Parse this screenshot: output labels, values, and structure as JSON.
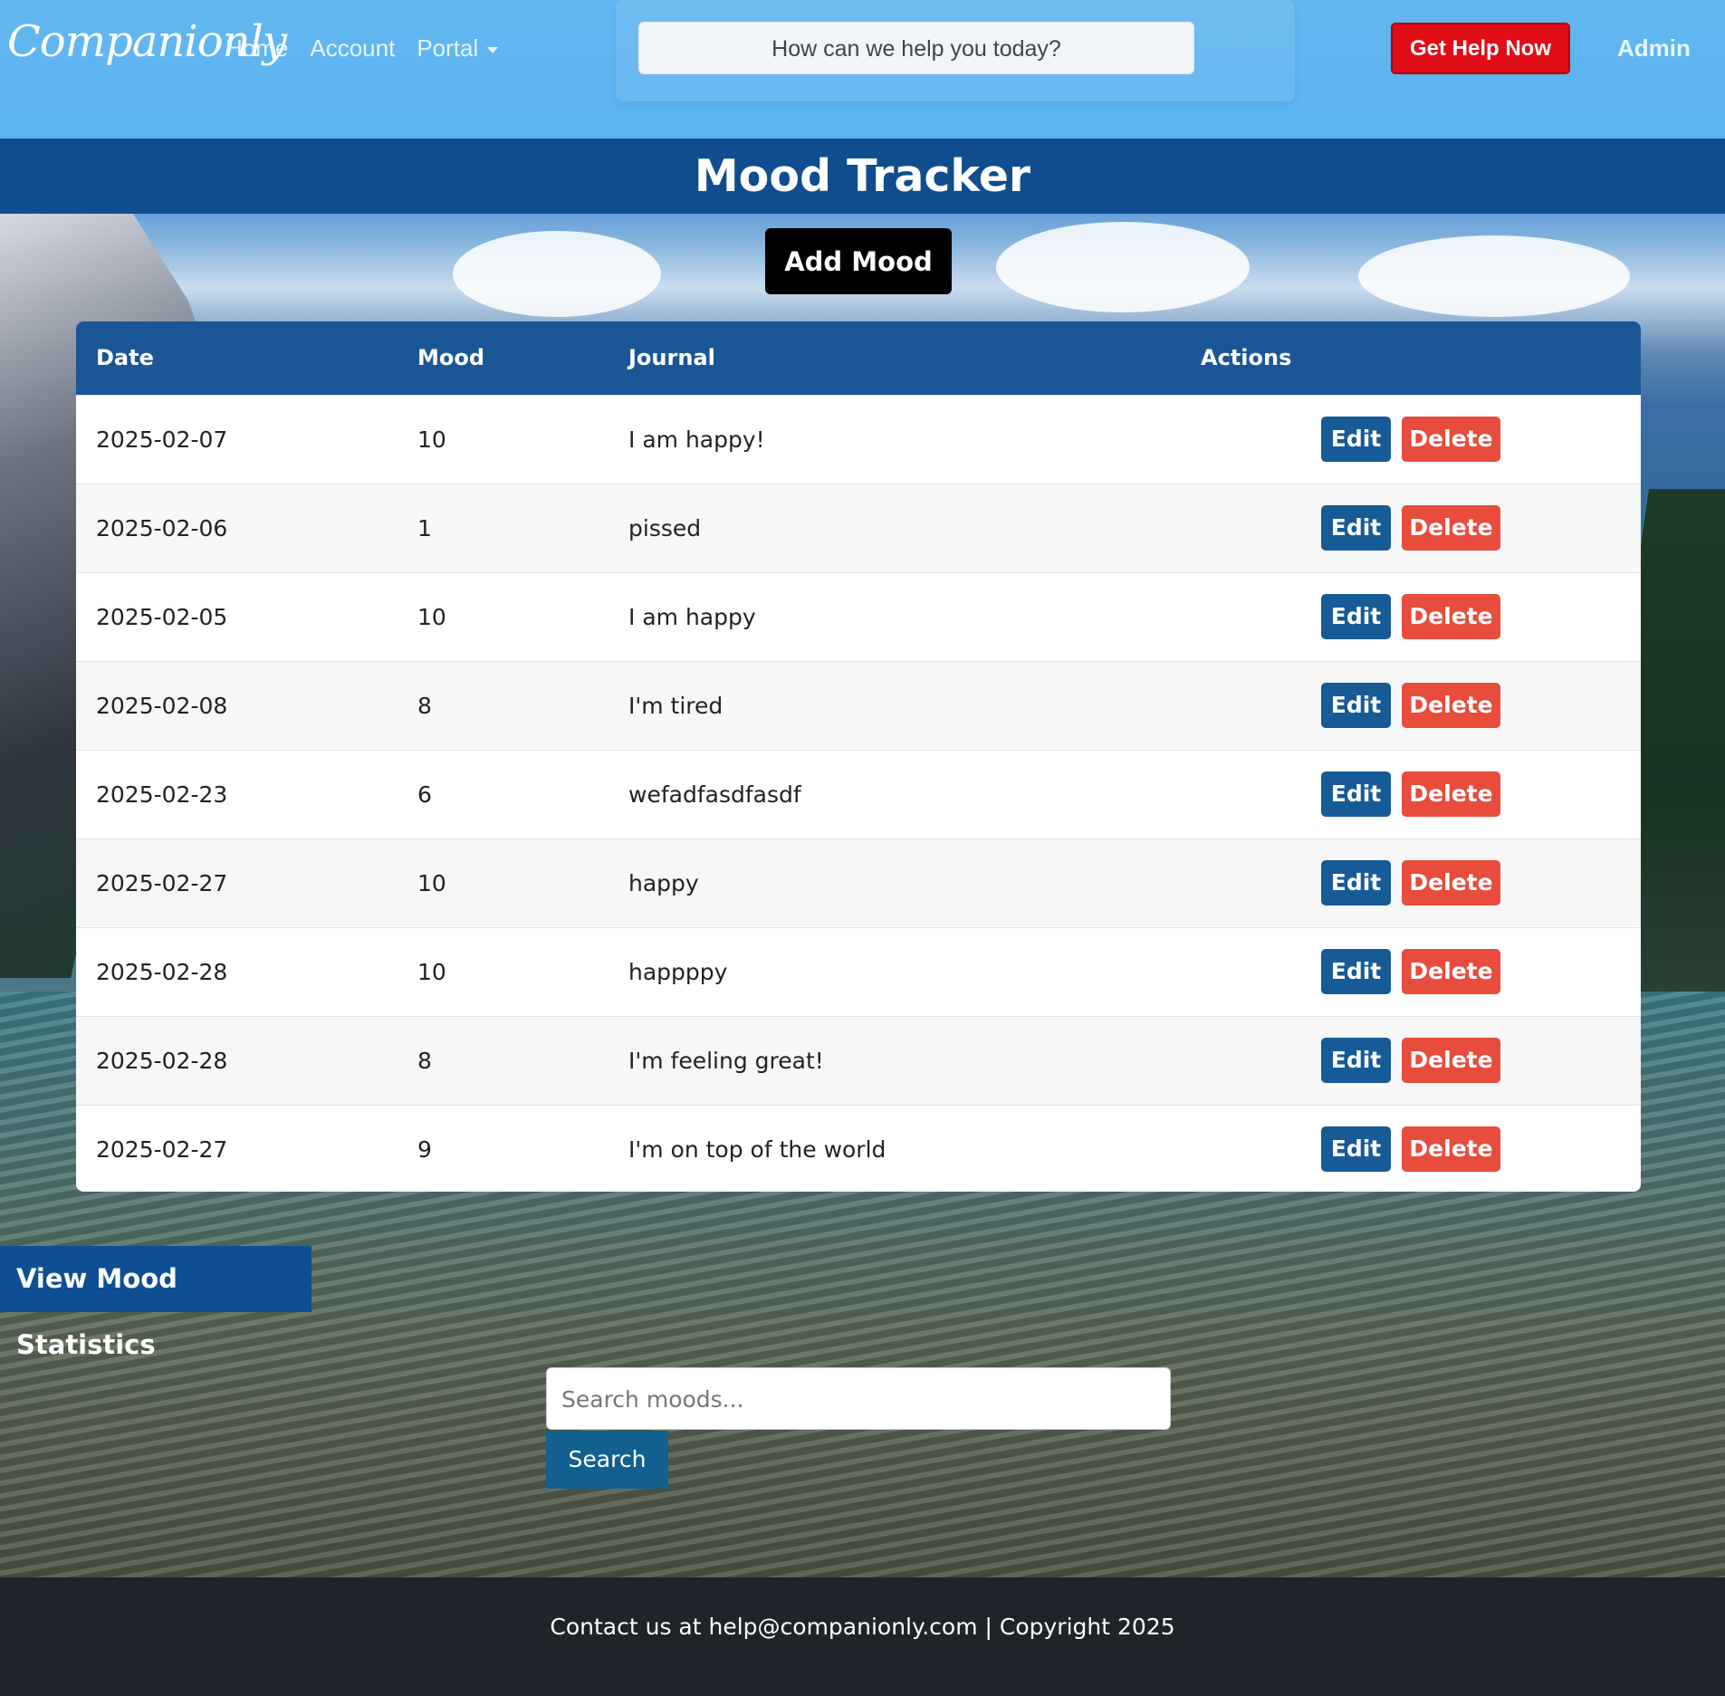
{
  "header": {
    "brand": "Companionly",
    "nav": [
      {
        "label": "Home"
      },
      {
        "label": "Account"
      },
      {
        "label": "Portal"
      }
    ],
    "help_search_placeholder": "How can we help you today?",
    "get_help_label": "Get Help Now",
    "admin_label": "Admin"
  },
  "page": {
    "title": "Mood Tracker",
    "add_mood_label": "Add Mood"
  },
  "table": {
    "columns": [
      "Date",
      "Mood",
      "Journal",
      "Actions"
    ],
    "rows": [
      {
        "date": "2025-02-07",
        "mood": "10",
        "journal": "I am happy!"
      },
      {
        "date": "2025-02-06",
        "mood": "1",
        "journal": "pissed"
      },
      {
        "date": "2025-02-05",
        "mood": "10",
        "journal": "I am happy"
      },
      {
        "date": "2025-02-08",
        "mood": "8",
        "journal": "I'm tired"
      },
      {
        "date": "2025-02-23",
        "mood": "6",
        "journal": "wefadfasdfasdf"
      },
      {
        "date": "2025-02-27",
        "mood": "10",
        "journal": "happy"
      },
      {
        "date": "2025-02-28",
        "mood": "10",
        "journal": "happppy"
      },
      {
        "date": "2025-02-28",
        "mood": "8",
        "journal": "I'm feeling great!"
      },
      {
        "date": "2025-02-27",
        "mood": "9",
        "journal": "I'm on top of the world"
      }
    ],
    "edit_label": "Edit",
    "delete_label": "Delete"
  },
  "stats": {
    "view_label": "View Mood Statistics"
  },
  "search": {
    "placeholder": "Search moods...",
    "button_label": "Search"
  },
  "footer": {
    "text": "Contact us at help@companionly.com | Copyright 2025"
  },
  "colors": {
    "topbar": "#5bb3f0",
    "title_band": "#0f4d8f",
    "table_header": "#1a5696",
    "edit": "#165a96",
    "delete": "#e74c3c",
    "get_help": "#e00c16",
    "footer": "#20232a"
  }
}
